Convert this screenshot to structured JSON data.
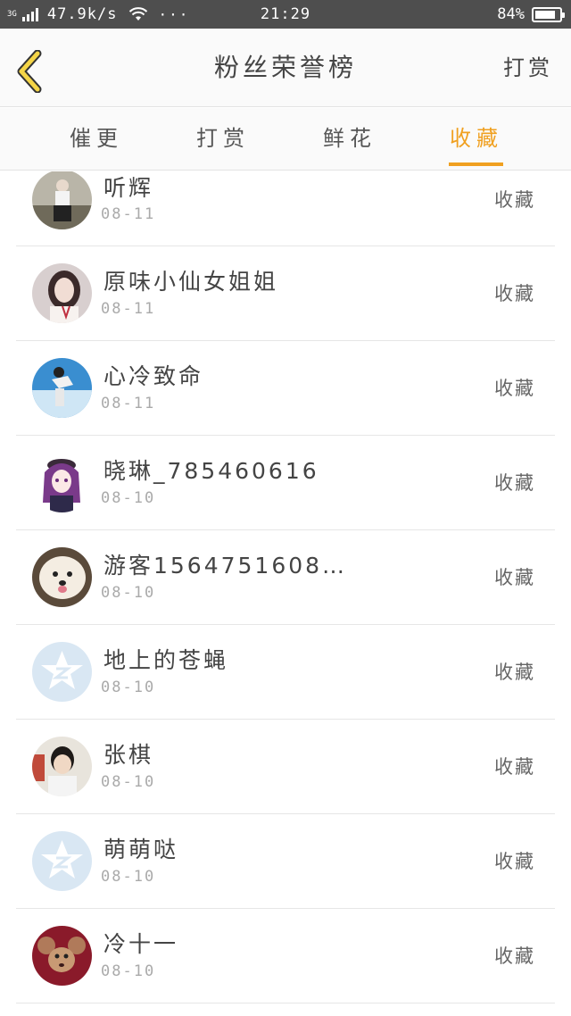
{
  "status_bar": {
    "network": "3G",
    "speed": "47.9k/s",
    "dots": "···",
    "time": "21:29",
    "battery": "84%",
    "battery_level": 0.84
  },
  "header": {
    "title": "粉丝荣誉榜",
    "action_label": "打赏"
  },
  "tabs": [
    {
      "label": "催更"
    },
    {
      "label": "打赏"
    },
    {
      "label": "鲜花"
    },
    {
      "label": "收藏"
    }
  ],
  "active_tab": "收藏",
  "colors": {
    "accent": "#f0a020",
    "status_bar_bg": "#4e4e4e"
  },
  "rows": [
    {
      "name": "听辉",
      "date": "08-11",
      "action": "收藏",
      "avatar": "photo-girl-outdoor"
    },
    {
      "name": "原味小仙女姐姐",
      "date": "08-11",
      "action": "收藏",
      "avatar": "photo-girl-portrait"
    },
    {
      "name": "心冷致命",
      "date": "08-11",
      "action": "收藏",
      "avatar": "photo-sky-figure"
    },
    {
      "name": "晓琳_785460616",
      "date": "08-10",
      "action": "收藏",
      "avatar": "anime-girl"
    },
    {
      "name": "游客1564751608…",
      "date": "08-10",
      "action": "收藏",
      "avatar": "photo-dog"
    },
    {
      "name": "地上的苍蝇",
      "date": "08-10",
      "action": "收藏",
      "avatar": "default-star"
    },
    {
      "name": "张棋",
      "date": "08-10",
      "action": "收藏",
      "avatar": "photo-boy"
    },
    {
      "name": "萌萌哒",
      "date": "08-10",
      "action": "收藏",
      "avatar": "default-star"
    },
    {
      "name": "冷十一",
      "date": "08-10",
      "action": "收藏",
      "avatar": "cartoon-mouse"
    }
  ]
}
